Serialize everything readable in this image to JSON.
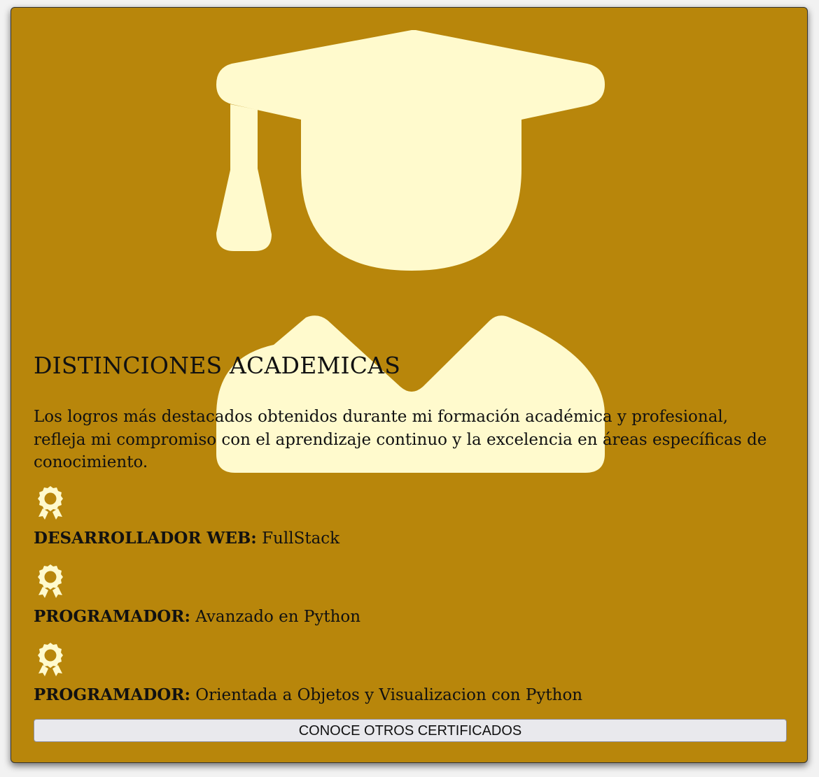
{
  "section": {
    "title": "DISTINCIONES ACADEMICAS",
    "description": "Los logros más destacados obtenidos durante mi formación académica y profesional, refleja mi compromiso con el aprendizaje continuo y la excelencia en áreas específicas de conocimiento.",
    "background_icon": "graduate-student-icon",
    "colors": {
      "card_background": "#b8860b",
      "icon_color": "#fffacd",
      "text_color": "#111111"
    }
  },
  "awards": [
    {
      "icon": "award-medal-icon",
      "label": "DESARROLLADOR WEB:",
      "value": " FullStack"
    },
    {
      "icon": "award-medal-icon",
      "label": "PROGRAMADOR:",
      "value": " Avanzado en Python"
    },
    {
      "icon": "award-medal-icon",
      "label": "PROGRAMADOR:",
      "value": " Orientada a Objetos y Visualizacion con Python"
    }
  ],
  "button": {
    "label": "CONOCE OTROS CERTIFICADOS"
  }
}
